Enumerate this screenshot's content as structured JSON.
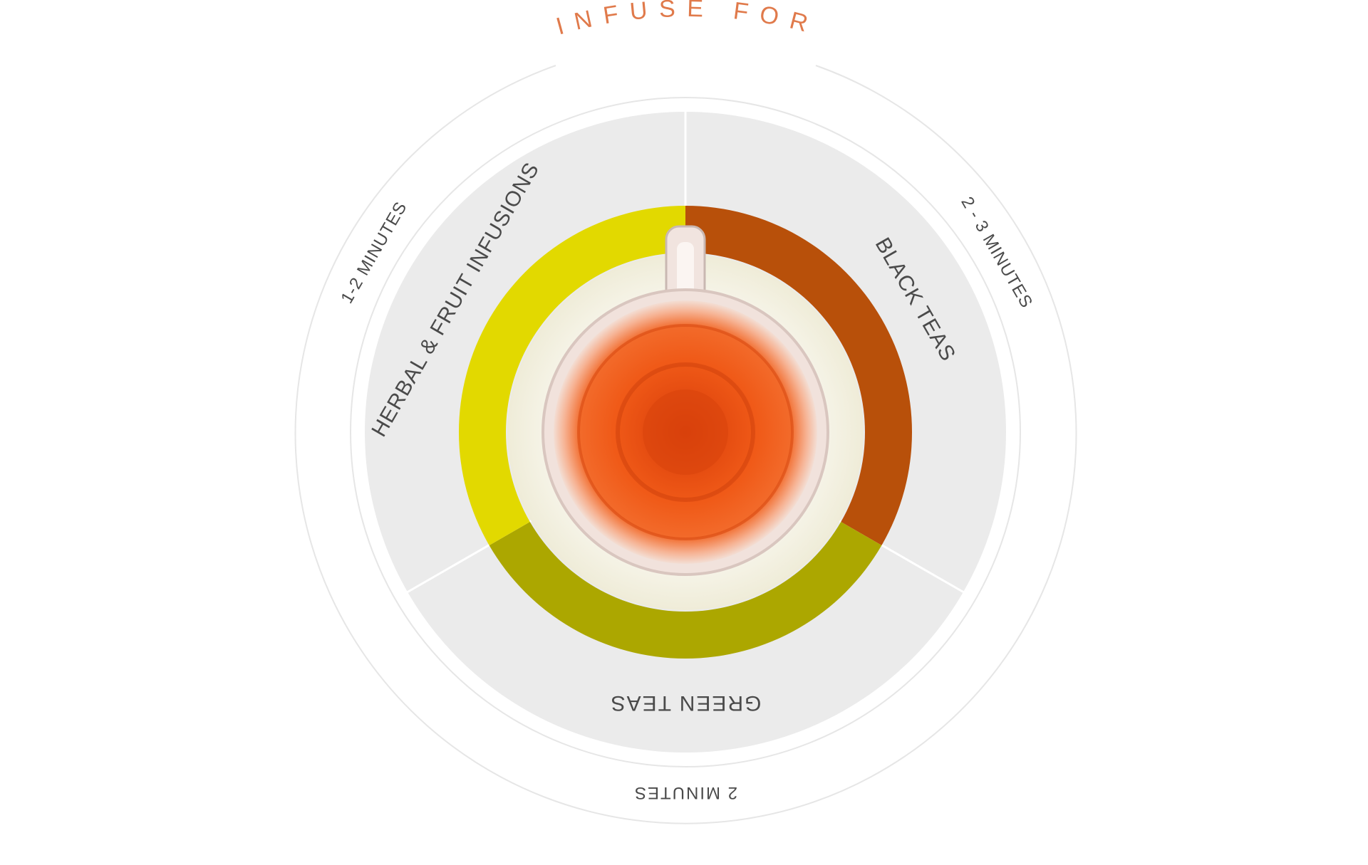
{
  "title": "INFUSE FOR",
  "colors": {
    "title": "#e07a4b",
    "background": "#ffffff",
    "segment_bg": "#ebebeb",
    "outer_ring": "#e6e6e6",
    "saucer": "#f5f3e6",
    "herbal": "#e2d900",
    "black": "#b8500a",
    "green": "#aca700",
    "tea_center": "#e84a10",
    "tea_edge": "#f7c4a8"
  },
  "segments": [
    {
      "key": "herbal",
      "name": "HERBAL & FRUIT INFUSIONS",
      "time": "1-2 MINUTES"
    },
    {
      "key": "black",
      "name": "BLACK TEAS",
      "time": "2 - 3 MINUTES"
    },
    {
      "key": "green",
      "name": "GREEN TEAS",
      "time": "2 MINUTES"
    }
  ],
  "image": {
    "subject": "cup-of-tea-top-view"
  }
}
